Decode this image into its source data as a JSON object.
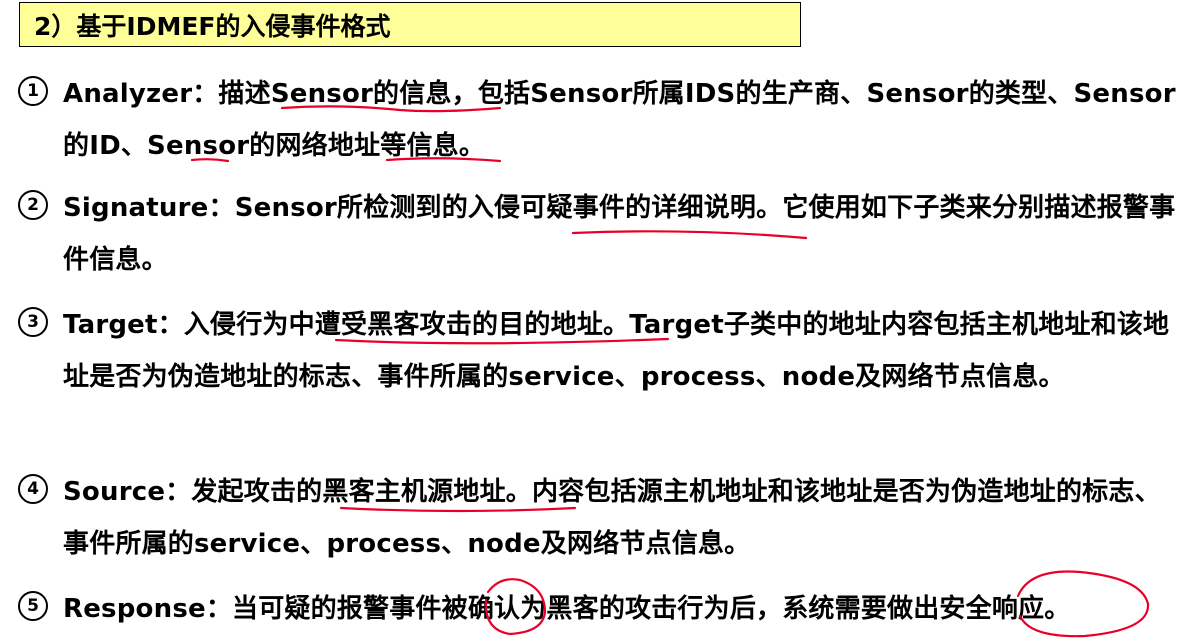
{
  "title": "2）基于IDMEF的入侵事件格式",
  "items": [
    {
      "number": "1",
      "text": "Analyzer：描述Sensor的信息，包括Sensor所属IDS的生产商、Sensor的类型、Sensor的ID、Sensor的网络地址等信息。"
    },
    {
      "number": "2",
      "text": "Signature：Sensor所检测到的入侵可疑事件的详细说明。它使用如下子类来分别描述报警事件信息。"
    },
    {
      "number": "3",
      "text": "Target：入侵行为中遭受黑客攻击的目的地址。Target子类中的地址内容包括主机地址和该地址是否为伪造地址的标志、事件所属的service、process、node及网络节点信息。"
    },
    {
      "number": "4",
      "text": "Source：发起攻击的黑客主机源地址。内容包括源主机地址和该地址是否为伪造地址的标志、事件所属的service、process、node及网络节点信息。"
    },
    {
      "number": "5",
      "text": "Response：当可疑的报警事件被确认为黑客的攻击行为后，系统需要做出安全响应。"
    }
  ],
  "colors": {
    "title_bg": "#ffff99",
    "annotation": "#e8002a"
  }
}
